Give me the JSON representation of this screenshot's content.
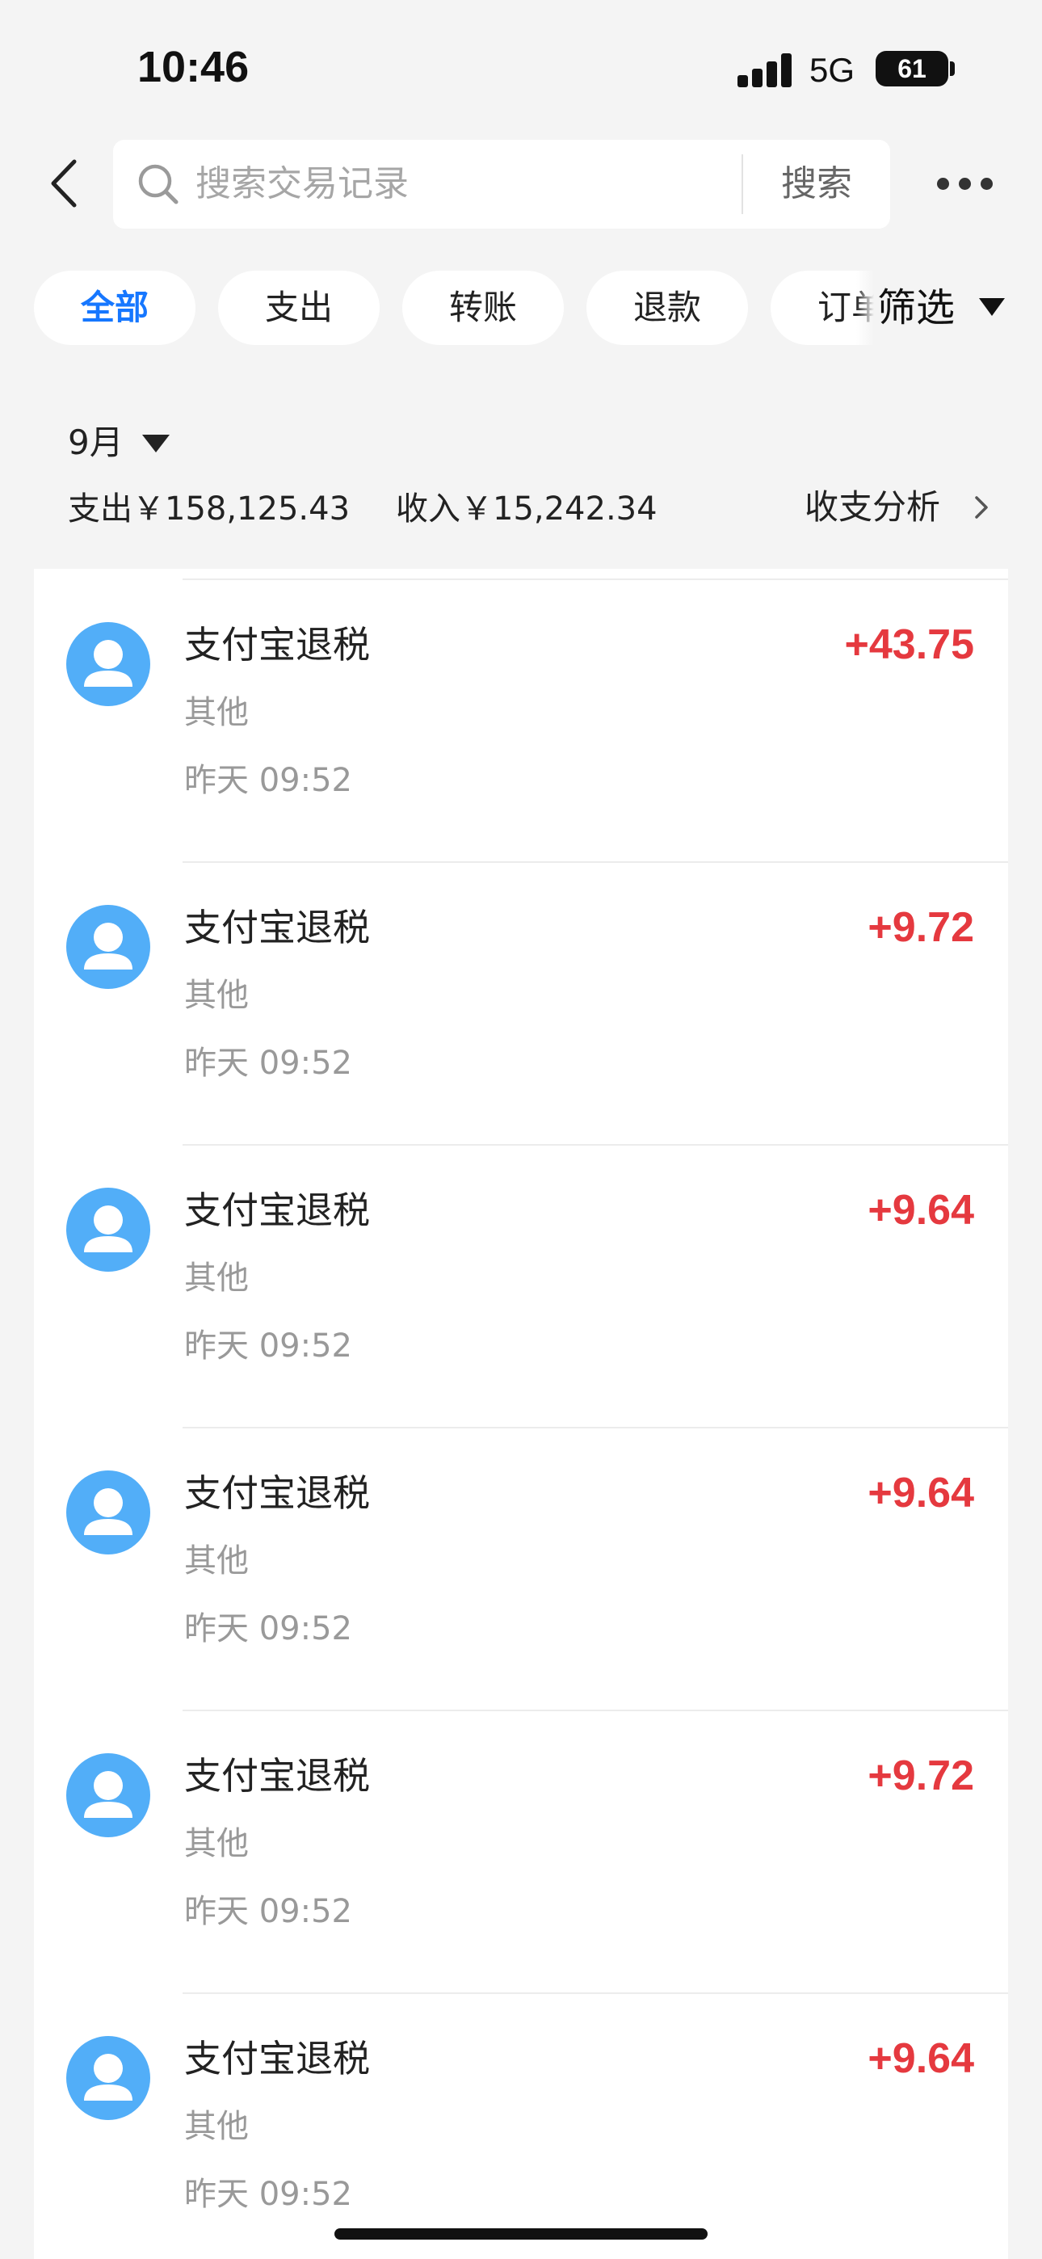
{
  "status_bar": {
    "time": "10:46",
    "network": "5G",
    "battery": "61"
  },
  "header": {
    "search_placeholder": "搜索交易记录",
    "search_button": "搜索"
  },
  "filters": {
    "chips": [
      {
        "label": "全部",
        "active": true
      },
      {
        "label": "支出",
        "active": false
      },
      {
        "label": "转账",
        "active": false
      },
      {
        "label": "退款",
        "active": false
      },
      {
        "label": "订单",
        "active": false
      }
    ],
    "filter_button": "筛选"
  },
  "summary": {
    "month": "9月",
    "expense": "支出￥158,125.43",
    "income": "收入￥15,242.34",
    "analysis": "收支分析"
  },
  "transactions": [
    {
      "title": "支付宝退税",
      "category": "其他",
      "time": "昨天 09:52",
      "amount": "+43.75"
    },
    {
      "title": "支付宝退税",
      "category": "其他",
      "time": "昨天 09:52",
      "amount": "+9.72"
    },
    {
      "title": "支付宝退税",
      "category": "其他",
      "time": "昨天 09:52",
      "amount": "+9.64"
    },
    {
      "title": "支付宝退税",
      "category": "其他",
      "time": "昨天 09:52",
      "amount": "+9.64"
    },
    {
      "title": "支付宝退税",
      "category": "其他",
      "time": "昨天 09:52",
      "amount": "+9.72"
    },
    {
      "title": "支付宝退税",
      "category": "其他",
      "time": "昨天 09:52",
      "amount": "+9.64"
    }
  ],
  "colors": {
    "accent": "#1677ff",
    "income_amount": "#e5393f",
    "avatar": "#52aef8",
    "background": "#f4f4f4"
  },
  "icons": {
    "back": "chevron-left-icon",
    "search": "search-icon",
    "more": "more-dots-icon",
    "filter_caret": "caret-down-icon",
    "analysis": "chevron-right-icon",
    "avatar": "user-avatar-icon"
  }
}
